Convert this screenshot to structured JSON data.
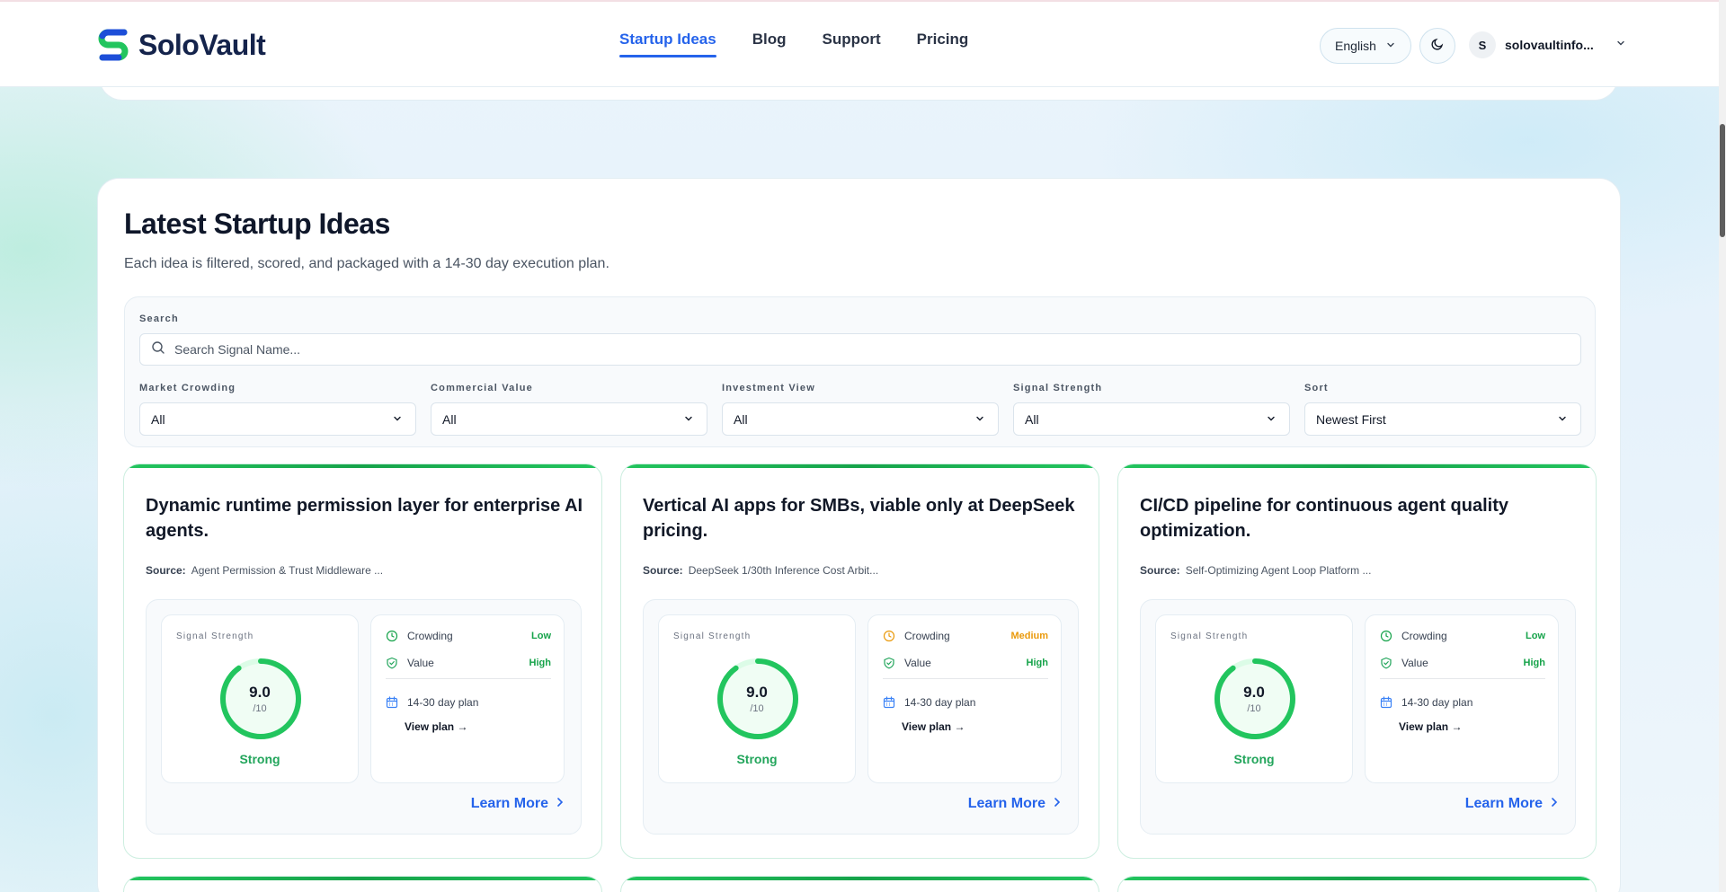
{
  "header": {
    "brand": "SoloVault",
    "nav": [
      {
        "label": "Startup Ideas"
      },
      {
        "label": "Blog"
      },
      {
        "label": "Support"
      },
      {
        "label": "Pricing"
      }
    ],
    "language": "English",
    "user": {
      "initial": "S",
      "name": "solovaultinfo..."
    }
  },
  "main": {
    "title": "Latest Startup Ideas",
    "subtitle": "Each idea is filtered, scored, and packaged with a 14-30 day execution plan.",
    "search": {
      "label": "Search",
      "placeholder": "Search Signal Name..."
    },
    "filters": [
      {
        "label": "Market Crowding",
        "value": "All"
      },
      {
        "label": "Commercial Value",
        "value": "All"
      },
      {
        "label": "Investment View",
        "value": "All"
      },
      {
        "label": "Signal Strength",
        "value": "All"
      },
      {
        "label": "Sort",
        "value": "Newest First"
      }
    ]
  },
  "cards": [
    {
      "title": "Dynamic runtime permission layer for enterprise AI agents.",
      "source_label": "Source:",
      "source": "Agent Permission & Trust Middleware ...",
      "signal_label": "Signal Strength",
      "score": "9.0",
      "score_max": "/10",
      "score_fraction": 0.9,
      "strength": "Strong",
      "crowding_label": "Crowding",
      "crowding": "Low",
      "crowding_color": "#16a34a",
      "value_label": "Value",
      "value": "High",
      "plan": "14-30 day plan",
      "view_plan": "View plan →",
      "learn_more": "Learn More"
    },
    {
      "title": "Vertical AI apps for SMBs, viable only at DeepSeek pricing.",
      "source_label": "Source:",
      "source": "DeepSeek 1/30th Inference Cost Arbit...",
      "signal_label": "Signal Strength",
      "score": "9.0",
      "score_max": "/10",
      "score_fraction": 0.9,
      "strength": "Strong",
      "crowding_label": "Crowding",
      "crowding": "Medium",
      "crowding_color": "#ea9a0c",
      "value_label": "Value",
      "value": "High",
      "plan": "14-30 day plan",
      "view_plan": "View plan →",
      "learn_more": "Learn More"
    },
    {
      "title": "CI/CD pipeline for continuous agent quality optimization.",
      "source_label": "Source:",
      "source": "Self-Optimizing Agent Loop Platform ...",
      "signal_label": "Signal Strength",
      "score": "9.0",
      "score_max": "/10",
      "score_fraction": 0.9,
      "strength": "Strong",
      "crowding_label": "Crowding",
      "crowding": "Low",
      "crowding_color": "#16a34a",
      "value_label": "Value",
      "value": "High",
      "plan": "14-30 day plan",
      "view_plan": "View plan →",
      "learn_more": "Learn More"
    }
  ],
  "colors": {
    "accent": "#2563eb",
    "success": "#22c55e",
    "warning": "#ea9a0c"
  }
}
